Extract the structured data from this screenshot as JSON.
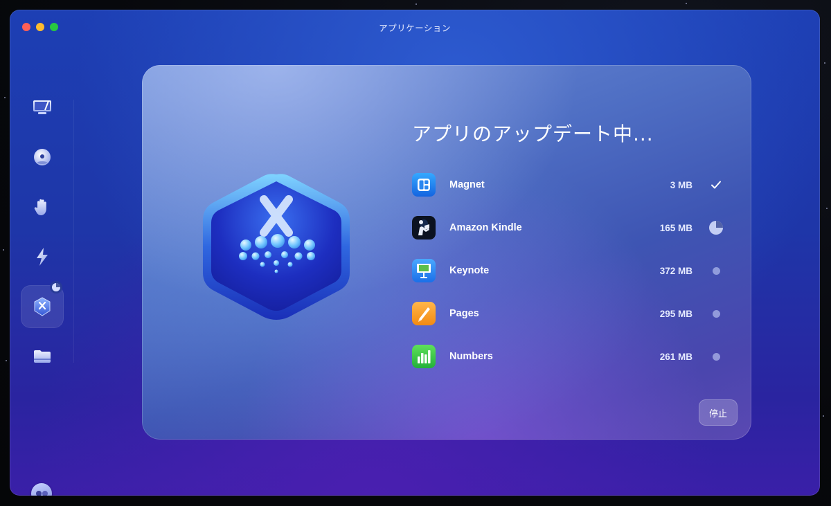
{
  "window": {
    "title": "アプリケーション"
  },
  "sidebar": {
    "items": [
      {
        "name": "sidebar-item-cleanup",
        "icon": "monitor-sweep-icon",
        "active": false
      },
      {
        "name": "sidebar-item-protection",
        "icon": "shield-orb-icon",
        "active": false
      },
      {
        "name": "sidebar-item-privacy",
        "icon": "hand-icon",
        "active": false
      },
      {
        "name": "sidebar-item-performance",
        "icon": "lightning-icon",
        "active": true
      },
      {
        "name": "sidebar-item-applications",
        "icon": "app-updater-icon",
        "active": true,
        "badge": "progress-pie-icon"
      },
      {
        "name": "sidebar-item-files",
        "icon": "folder-icon",
        "active": false
      }
    ],
    "assistant_icon": "assistant-icon"
  },
  "main": {
    "heading": "アプリのアップデート中...",
    "hero_icon": "updater-hexagon-icon",
    "apps": [
      {
        "name": "Magnet",
        "size": "3 MB",
        "status": "done",
        "icon": "magnet-app-icon"
      },
      {
        "name": "Amazon Kindle",
        "size": "165 MB",
        "status": "in-progress",
        "progress": 0.25,
        "icon": "kindle-app-icon"
      },
      {
        "name": "Keynote",
        "size": "372 MB",
        "status": "pending",
        "icon": "keynote-app-icon"
      },
      {
        "name": "Pages",
        "size": "295 MB",
        "status": "pending",
        "icon": "pages-app-icon"
      },
      {
        "name": "Numbers",
        "size": "261 MB",
        "status": "pending",
        "icon": "numbers-app-icon"
      }
    ],
    "stop_button": "停止"
  },
  "colors": {
    "window_top": "#1d3fb4",
    "window_bottom": "#3a1fa8",
    "card_top": "#6f8fd8",
    "card_bottom": "#5a48b2"
  }
}
